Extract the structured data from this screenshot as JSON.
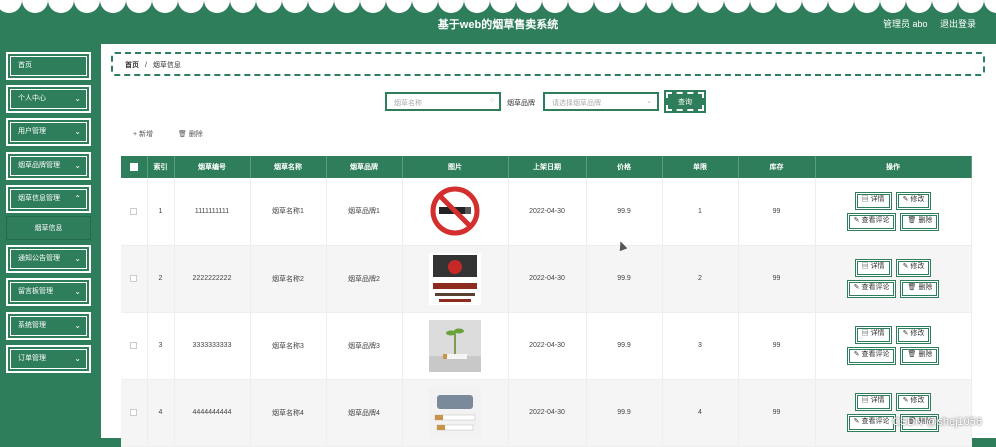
{
  "header": {
    "title": "基于web的烟草售卖系统",
    "user": "管理员 abo",
    "logout": "退出登录"
  },
  "sidebar": {
    "items": [
      {
        "label": "首页",
        "chevron": false
      },
      {
        "label": "个人中心",
        "chevron": true
      },
      {
        "label": "用户管理",
        "chevron": true
      },
      {
        "label": "烟草品牌管理",
        "chevron": true
      },
      {
        "label": "烟草信息管理",
        "chevron": true
      },
      {
        "label": "通知公告管理",
        "chevron": true
      },
      {
        "label": "留言板管理",
        "chevron": true
      },
      {
        "label": "系统管理",
        "chevron": true
      },
      {
        "label": "订单管理",
        "chevron": true
      }
    ],
    "sub_item": "烟草信息"
  },
  "breadcrumb": {
    "home": "首页",
    "sep": "/",
    "current": "烟草信息"
  },
  "search": {
    "name_placeholder": "烟草名称",
    "brand_label": "烟草品牌",
    "brand_placeholder": "请选择烟草品牌",
    "query": "查询"
  },
  "actions": {
    "add": "+ 新增",
    "delete": "删除"
  },
  "table": {
    "headers": [
      "",
      "索引",
      "烟草编号",
      "烟草名称",
      "烟草品牌",
      "图片",
      "上架日期",
      "价格",
      "单限",
      "库存",
      "操作"
    ],
    "rows": [
      {
        "index": "1",
        "code": "1111111111",
        "name": "烟草名称1",
        "brand": "烟草品牌1",
        "date": "2022-04-30",
        "price": "99.9",
        "limit": "1",
        "stock": "99",
        "image": "no-smoking-sign"
      },
      {
        "index": "2",
        "code": "2222222222",
        "name": "烟草名称2",
        "brand": "烟草品牌2",
        "date": "2022-04-30",
        "price": "99.9",
        "limit": "2",
        "stock": "99",
        "image": "anti-smoking-poster"
      },
      {
        "index": "3",
        "code": "3333333333",
        "name": "烟草名称3",
        "brand": "烟草品牌3",
        "date": "2022-04-30",
        "price": "99.9",
        "limit": "3",
        "stock": "99",
        "image": "sprout-cigarette"
      },
      {
        "index": "4",
        "code": "4444444444",
        "name": "烟草名称4",
        "brand": "烟草品牌4",
        "date": "2022-04-30",
        "price": "99.9",
        "limit": "4",
        "stock": "99",
        "image": "stop-cigarettes"
      }
    ],
    "buttons": {
      "detail": "详情",
      "edit": "修改",
      "comments": "查看评论",
      "remove": "删除"
    }
  },
  "watermark": "CSDN @shej1056",
  "colors": {
    "primary": "#2e7d5b",
    "white": "#ffffff"
  }
}
